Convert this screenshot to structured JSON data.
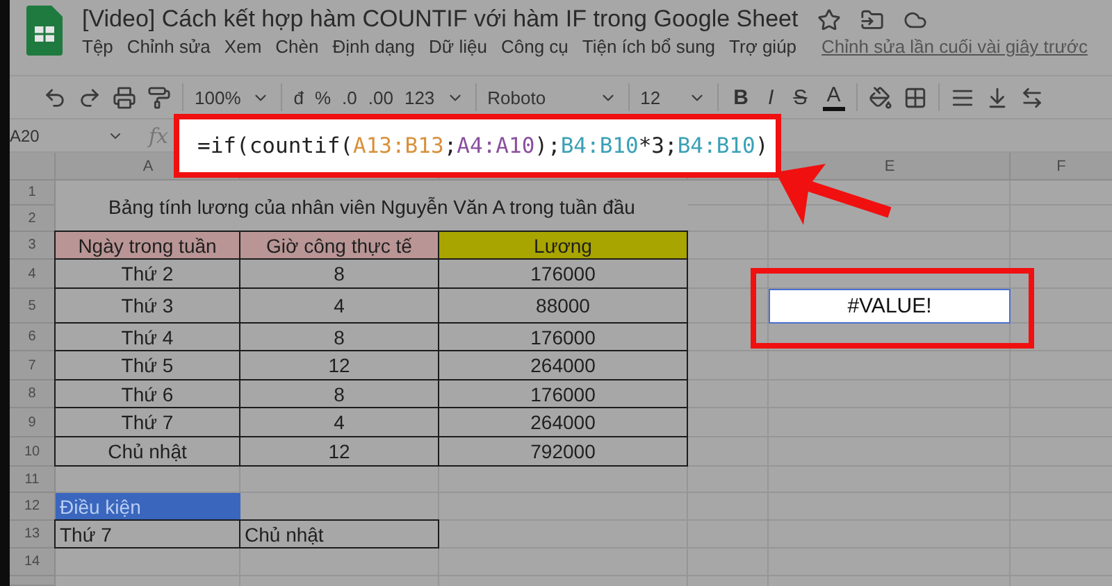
{
  "document": {
    "title": "[Video] Cách kết hợp hàm COUNTIF với hàm IF trong Google Sheet"
  },
  "menu": {
    "items": [
      "Tệp",
      "Chỉnh sửa",
      "Xem",
      "Chèn",
      "Định dạng",
      "Dữ liệu",
      "Công cụ",
      "Tiện ích bổ sung",
      "Trợ giúp"
    ],
    "last_edit": "Chỉnh sửa lần cuối vài giây trước"
  },
  "toolbar": {
    "zoom": "100%",
    "number_formats": [
      "đ",
      "%",
      ".0",
      ".00",
      "123"
    ],
    "font": "Roboto",
    "font_size": "12",
    "text_styles": [
      "B",
      "I",
      "S",
      "A"
    ]
  },
  "formula_bar": {
    "name_box": "A20",
    "fx": "fx"
  },
  "formula_callout": {
    "segments": [
      {
        "text": "=if(countif(",
        "color": "#222222"
      },
      {
        "text": "A13:B13",
        "color": "#d9903a"
      },
      {
        "text": ";",
        "color": "#222222"
      },
      {
        "text": "A4:A10",
        "color": "#8a4f9e"
      },
      {
        "text": ");",
        "color": "#222222"
      },
      {
        "text": "B4:B10",
        "color": "#3aa0b5"
      },
      {
        "text": "*3;",
        "color": "#222222"
      },
      {
        "text": "B4:B10",
        "color": "#3aa0b5"
      },
      {
        "text": ")",
        "color": "#222222"
      }
    ]
  },
  "column_headers": [
    "A",
    "E",
    "F"
  ],
  "title_cell": {
    "text": "Bảng tính lương của nhân viên Nguyễn Văn A trong tuần đầu"
  },
  "rows": [
    {
      "number": "1"
    },
    {
      "number": "2"
    },
    {
      "number": "3",
      "cells": [
        {
          "kind": "table",
          "text": "Ngày trong tuần",
          "color": "#b99595"
        },
        {
          "kind": "table",
          "text": "Giờ công thực tế",
          "color": "#b99595"
        },
        {
          "kind": "table",
          "text": "Lương",
          "color": "#a8a400"
        }
      ]
    },
    {
      "number": "4",
      "cells": [
        {
          "kind": "table",
          "text": "Thứ 2"
        },
        {
          "kind": "table",
          "text": "8"
        },
        {
          "kind": "table",
          "text": "176000"
        }
      ]
    },
    {
      "number": "5",
      "cells": [
        {
          "kind": "table",
          "text": "Thứ 3"
        },
        {
          "kind": "table",
          "text": "4"
        },
        {
          "kind": "table",
          "text": "88000"
        }
      ]
    },
    {
      "number": "6",
      "cells": [
        {
          "kind": "table",
          "text": "Thứ 4"
        },
        {
          "kind": "table",
          "text": "8"
        },
        {
          "kind": "table",
          "text": "176000"
        }
      ]
    },
    {
      "number": "7",
      "cells": [
        {
          "kind": "table",
          "text": "Thứ 5"
        },
        {
          "kind": "table",
          "text": "12"
        },
        {
          "kind": "table",
          "text": "264000"
        }
      ]
    },
    {
      "number": "8",
      "cells": [
        {
          "kind": "table",
          "text": "Thứ 6"
        },
        {
          "kind": "table",
          "text": "8"
        },
        {
          "kind": "table",
          "text": "176000"
        }
      ]
    },
    {
      "number": "9",
      "cells": [
        {
          "kind": "table",
          "text": "Thứ 7"
        },
        {
          "kind": "table",
          "text": "4"
        },
        {
          "kind": "table",
          "text": "264000"
        }
      ]
    },
    {
      "number": "10",
      "cells": [
        {
          "kind": "table",
          "text": "Chủ nhật"
        },
        {
          "kind": "table",
          "text": "12"
        },
        {
          "kind": "table",
          "text": "792000"
        }
      ]
    },
    {
      "number": "11"
    },
    {
      "number": "12",
      "cells": [
        {
          "kind": "label",
          "text": "Điều kiện",
          "color": "#3a66bd"
        }
      ]
    },
    {
      "number": "13",
      "cells": [
        {
          "kind": "entry",
          "text": "Thứ 7"
        },
        {
          "kind": "entry",
          "text": "Chủ nhật"
        }
      ]
    },
    {
      "number": "14"
    }
  ],
  "result_cell": {
    "text": "#VALUE!",
    "selected": true
  }
}
